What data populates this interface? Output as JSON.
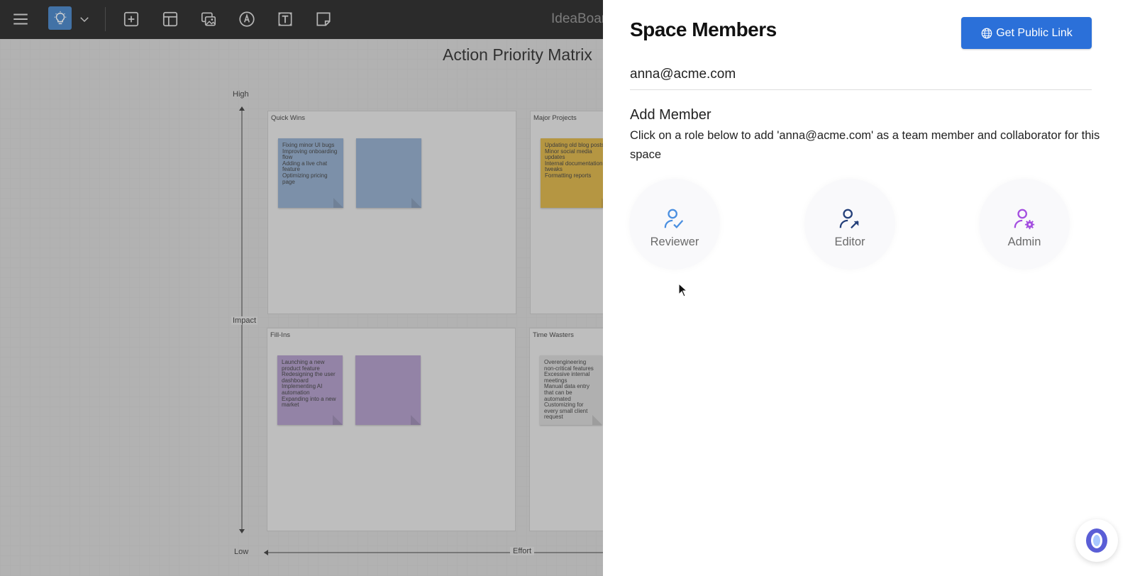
{
  "toolbar": {
    "app_name": "IdeaBoar",
    "icons": [
      "menu-icon",
      "lightbulb-icon",
      "chevron-down-icon",
      "add-box-icon",
      "layout-icon",
      "image-icon",
      "pen-icon",
      "text-icon",
      "sticky-note-icon"
    ]
  },
  "board": {
    "title": "Action Priority Matrix",
    "axis": {
      "high": "High",
      "low": "Low",
      "impact": "Impact",
      "effort": "Effort"
    },
    "quadrants": {
      "quick_wins": {
        "title": "Quick Wins",
        "note": "Fixing minor UI bugs\nImproving onboarding flow\nAdding a live chat feature\nOptimizing pricing page"
      },
      "major_projects": {
        "title": "Major Projects",
        "note": "Updating old blog posts\nMinor social media updates\nInternal documentation tweaks\nFormatting reports"
      },
      "fill_ins": {
        "title": "Fill-Ins",
        "note": "Launching a new product feature\nRedesigning the user dashboard\nImplementing AI automation\nExpanding into a new market"
      },
      "time_wasters": {
        "title": "Time Wasters",
        "note": "Overengineering non-critical features\nExcessive internal meetings\nManual data entry that can be automated\nCustomizing for every small client request"
      }
    },
    "colors": {
      "blue_note": "#8aa6c8",
      "yellow_note": "#d9ad3a",
      "purple_note": "#a994c4",
      "grey_note": "#d2d2d2"
    }
  },
  "panel": {
    "title": "Space Members",
    "public_link_button": "Get Public Link",
    "email": "anna@acme.com",
    "add_member_title": "Add Member",
    "add_member_description": "Click on a role below to add 'anna@acme.com' as a team member and collaborator for this space",
    "roles": [
      {
        "label": "Reviewer",
        "icon": "user-check-icon",
        "color": "#4a8fe0"
      },
      {
        "label": "Editor",
        "icon": "user-edit-icon",
        "color": "#24407a"
      },
      {
        "label": "Admin",
        "icon": "user-gear-icon",
        "color": "#a44ee0"
      }
    ],
    "accent": "#2b70d9"
  }
}
